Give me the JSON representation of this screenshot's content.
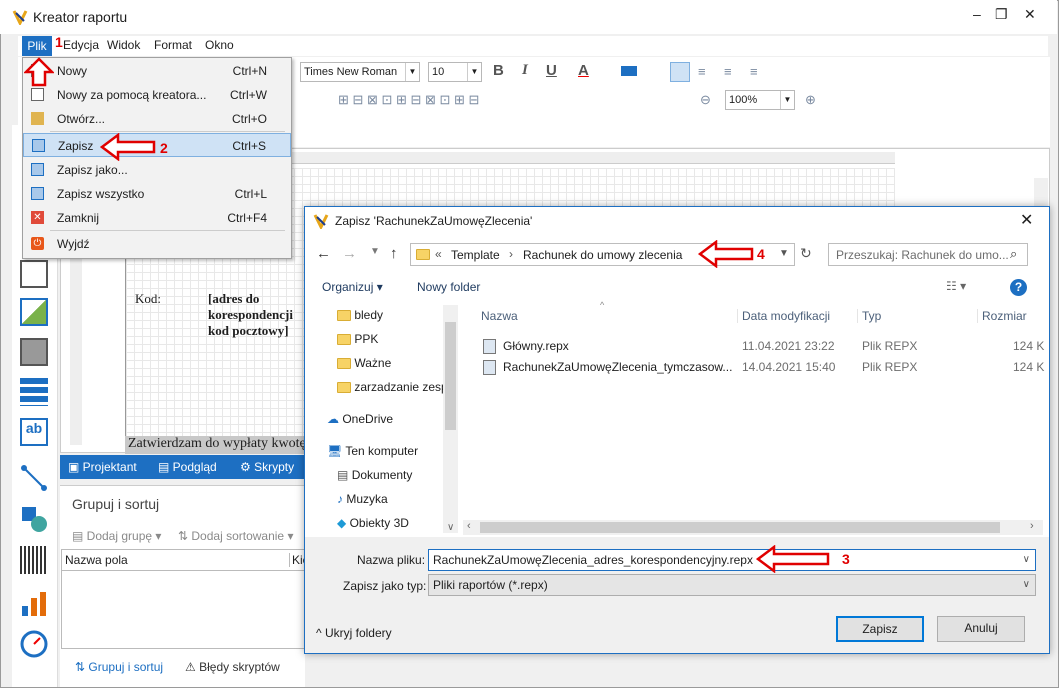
{
  "window": {
    "title": "Kreator raportu",
    "controls": [
      "–",
      "❐",
      "✕"
    ]
  },
  "menu": [
    "Plik",
    "Edycja",
    "Widok",
    "Format",
    "Okno"
  ],
  "toolbar": {
    "font": "Times New Roman",
    "size": "10",
    "zoom": "100%"
  },
  "file_menu": {
    "items": [
      {
        "label": "Nowy",
        "shortcut": "Ctrl+N"
      },
      {
        "label": "Nowy za pomocą kreatora...",
        "shortcut": "Ctrl+W"
      },
      {
        "label": "Otwórz...",
        "shortcut": "Ctrl+O"
      },
      {
        "label": "Zapisz",
        "shortcut": "Ctrl+S"
      },
      {
        "label": "Zapisz jako...",
        "shortcut": ""
      },
      {
        "label": "Zapisz wszystko",
        "shortcut": "Ctrl+L"
      },
      {
        "label": "Zamknij",
        "shortcut": "Ctrl+F4"
      },
      {
        "label": "Wyjdź",
        "shortcut": ""
      }
    ]
  },
  "designer": {
    "kod_label": "Kod:",
    "adres_label": "[adres do korespondencji kod pocztowy]",
    "zatwierdzam": "Zatwierdzam do wypłaty kwotę",
    "tabs": [
      "Projektant",
      "Podgląd",
      "Skrypty"
    ]
  },
  "group_sort": {
    "title": "Grupuj i sortuj",
    "add_group": "Dodaj grupę",
    "add_sort": "Dodaj sortowanie",
    "col_field": "Nazwa pola",
    "col_other": "Kie",
    "tabs": [
      "Grupuj i sortuj",
      "Błędy skryptów"
    ]
  },
  "dialog": {
    "title": "Zapisz 'RachunekZaUmowęZlecenia'",
    "breadcrumb": [
      "Template",
      "Rachunek do umowy zlecenia"
    ],
    "search_placeholder": "Przeszukaj: Rachunek do umo...",
    "organize": "Organizuj",
    "new_folder": "Nowy folder",
    "nav": [
      "bledy",
      "PPK",
      "Ważne",
      "zarzadzanie zesp",
      "OneDrive",
      "Ten komputer",
      "Dokumenty",
      "Muzyka",
      "Obiekty 3D"
    ],
    "columns": [
      "Nazwa",
      "Data modyfikacji",
      "Typ",
      "Rozmiar"
    ],
    "files": [
      {
        "name": "Główny.repx",
        "date": "11.04.2021 23:22",
        "type": "Plik REPX",
        "size": "124 K"
      },
      {
        "name": "RachunekZaUmowęZlecenia_tymczasow...",
        "date": "14.04.2021 15:40",
        "type": "Plik REPX",
        "size": "124 K"
      }
    ],
    "filename_label": "Nazwa pliku:",
    "filename": "RachunekZaUmowęZlecenia_adres_korespondencyjny.repx",
    "filetype_label": "Zapisz jako typ:",
    "filetype": "Pliki raportów (*.repx)",
    "hide_folders": "Ukryj foldery",
    "save": "Zapisz",
    "cancel": "Anuluj"
  },
  "annotations": [
    "1",
    "2",
    "3",
    "4"
  ],
  "colors": {
    "accent": "#1d6fc2",
    "annotation": "#e00000",
    "highlight": "#cfe2f5"
  }
}
